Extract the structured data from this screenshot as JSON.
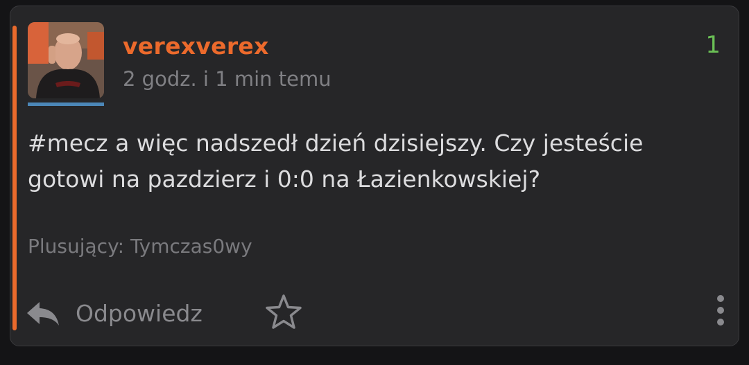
{
  "post": {
    "username": "verexverex",
    "timestamp": "2 godz. i 1 min temu",
    "vote_count": "1",
    "hashtag": "#mecz",
    "body_line1": " a więc nadszedł dzień dzisiejszy. Czy jesteście",
    "body_line2": "gotowi na pazdzierz i 0:0 na Łazienkowskiej?",
    "voters": "Plusujący: Tymczas0wy"
  },
  "actions": {
    "reply_label": "Odpowiedz",
    "reply_icon": "reply-icon",
    "favorite_icon": "star-icon",
    "more_icon": "more-vertical-icon"
  },
  "colors": {
    "accent": "#ec6a2c",
    "vote_positive": "#6abf55",
    "avatar_underline": "#4c87b8"
  }
}
